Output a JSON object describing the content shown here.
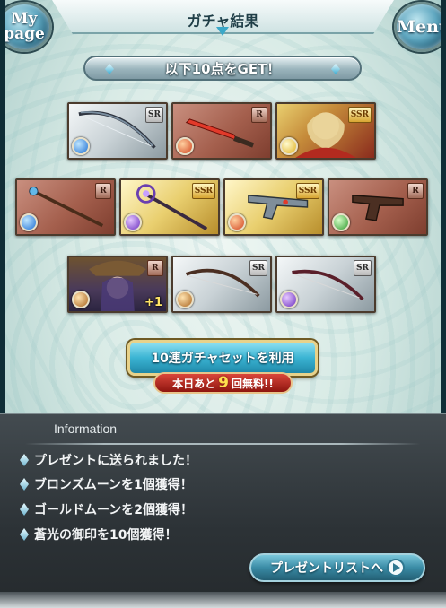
{
  "header": {
    "title": "ガチャ結果",
    "mypage_label_1": "My",
    "mypage_label_2": "page",
    "menu_label": "Menu"
  },
  "banner": {
    "text": "以下10点をGET！"
  },
  "cards": [
    {
      "rarity": "SR",
      "element": "water",
      "kind": "weapon"
    },
    {
      "rarity": "R",
      "element": "fire",
      "kind": "weapon"
    },
    {
      "rarity": "SSR",
      "element": "light",
      "kind": "character"
    },
    {
      "rarity": "R",
      "element": "water",
      "kind": "weapon"
    },
    {
      "rarity": "SSR",
      "element": "dark",
      "kind": "weapon"
    },
    {
      "rarity": "SSR",
      "element": "fire",
      "kind": "weapon"
    },
    {
      "rarity": "R",
      "element": "wind",
      "kind": "weapon"
    },
    {
      "rarity": "R",
      "element": "earth",
      "kind": "character",
      "plus": "+1"
    },
    {
      "rarity": "SR",
      "element": "earth",
      "kind": "weapon"
    },
    {
      "rarity": "SR",
      "element": "dark",
      "kind": "weapon"
    }
  ],
  "gacha_set": {
    "label": "10連ガチャセットを利用",
    "free_prefix": "本日あと",
    "free_count": "9",
    "free_suffix": "回無料!!"
  },
  "info": {
    "title": "Information",
    "items": [
      "プレゼントに送られました！",
      "ブロンズムーンを1個獲得！",
      "ゴールドムーンを2個獲得！",
      "蒼光の御印を10個獲得！"
    ],
    "present_button": "プレゼントリストへ"
  },
  "colors": {
    "accent": "#3bb4d3",
    "panel": "#2c3236",
    "free_badge": "#b0241a"
  }
}
